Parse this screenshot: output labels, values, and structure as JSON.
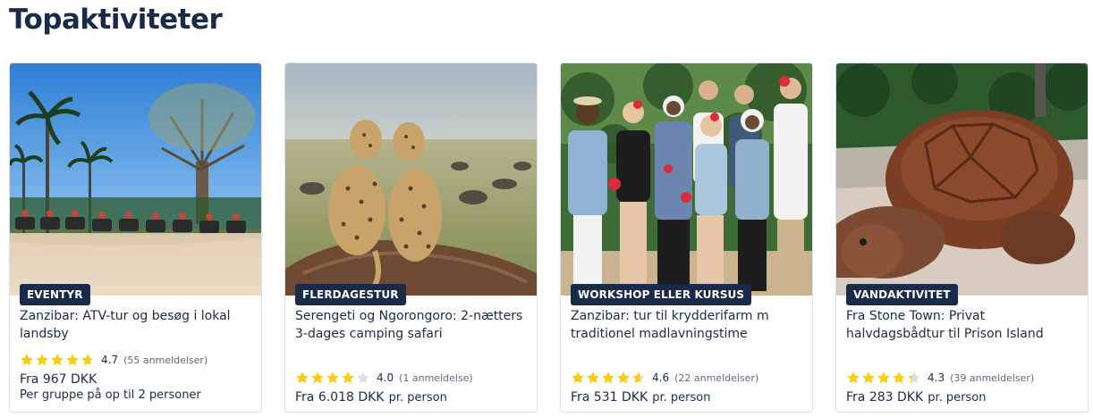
{
  "section": {
    "title": "Topaktiviteter"
  },
  "colors": {
    "navy": "#1a2b49",
    "star": "#fdcc0d",
    "star_empty": "#dcdfe4",
    "muted": "#63687a"
  },
  "cards": [
    {
      "category": "EVENTYR",
      "title": "Zanzibar: ATV-tur og besøg i lokal landsby",
      "rating": 4.7,
      "rating_text": "4.7",
      "reviews": "(55 anmeldelser)",
      "price": "Fra 967 DKK",
      "price_unit": "",
      "price_note": "Per gruppe på op til 2 personer",
      "image_icon": "atv-beach-photo"
    },
    {
      "category": "FLERDAGESTUR",
      "title": "Serengeti og Ngorongoro: 2-nætters 3-dages camping safari",
      "rating": 4.0,
      "rating_text": "4.0",
      "reviews": "(1 anmeldelse)",
      "price": "Fra 6.018 DKK",
      "price_unit": "pr. person",
      "price_note": "",
      "image_icon": "cheetahs-photo"
    },
    {
      "category": "WORKSHOP ELLER KURSUS",
      "title": "Zanzibar: tur til krydderifarm m traditionel madlavningstime",
      "rating": 4.6,
      "rating_text": "4.6",
      "reviews": "(22 anmeldelser)",
      "price": "Fra 531 DKK",
      "price_unit": "pr. person",
      "price_note": "",
      "image_icon": "group-photo"
    },
    {
      "category": "VANDAKTIVITET",
      "title": "Fra Stone Town: Privat halvdagsbådtur til Prison Island",
      "rating": 4.3,
      "rating_text": "4.3",
      "reviews": "(39 anmeldelser)",
      "price": "Fra 283 DKK",
      "price_unit": "pr. person",
      "price_note": "",
      "image_icon": "tortoise-photo"
    }
  ]
}
